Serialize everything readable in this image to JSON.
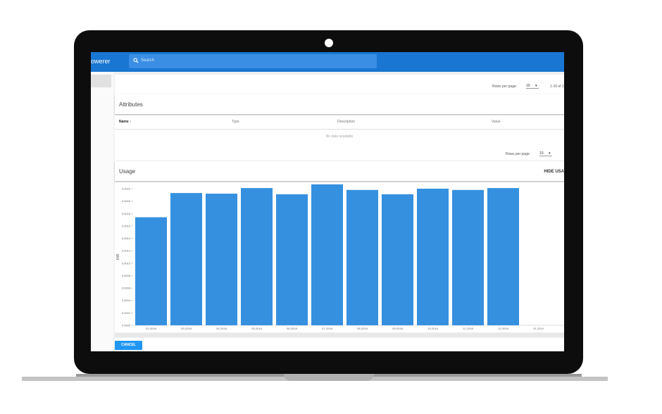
{
  "app": {
    "title": "owerer"
  },
  "search": {
    "placeholder": "Search",
    "icon": "search-icon"
  },
  "pagination_top": {
    "rows_label": "Rows per page:",
    "rows_value": "10",
    "range": "1-10 of 1"
  },
  "attributes": {
    "title": "Attributes",
    "columns": [
      "Name",
      "Type",
      "Description",
      "Value"
    ],
    "sort_icon": "arrow-up-icon",
    "empty": "No data available",
    "pagination": {
      "rows_label": "Rows per page:",
      "rows_value": "10"
    }
  },
  "usage": {
    "title": "Usage",
    "hide_label": "HIDE USA"
  },
  "chart_data": {
    "type": "bar",
    "ylabel": "MiB",
    "yticks": [
      "0.0022",
      "0.0020",
      "0.0018",
      "0.0016",
      "0.0014",
      "0.0012",
      "0.0010",
      "0.0008",
      "0.0006",
      "0.0004",
      "0.0002",
      "0.0000"
    ],
    "ylim": [
      0,
      0.0022
    ],
    "categories": [
      "02-2018",
      "03-2018",
      "04-2018",
      "05-2018",
      "06-2018",
      "07-2018",
      "08-2018",
      "09-2018",
      "10-2018",
      "11-2018",
      "12-2018",
      "01-2019"
    ],
    "values": [
      0.00174,
      0.00213,
      0.00212,
      0.00221,
      0.00211,
      0.00227,
      0.00218,
      0.00211,
      0.0022,
      0.00218,
      0.00221,
      null
    ],
    "bar_color": "#3590df",
    "grid": false
  },
  "actions": {
    "cancel": "CANCEL"
  },
  "colors": {
    "appbar": "#1976d2",
    "accent": "#2196f3"
  }
}
